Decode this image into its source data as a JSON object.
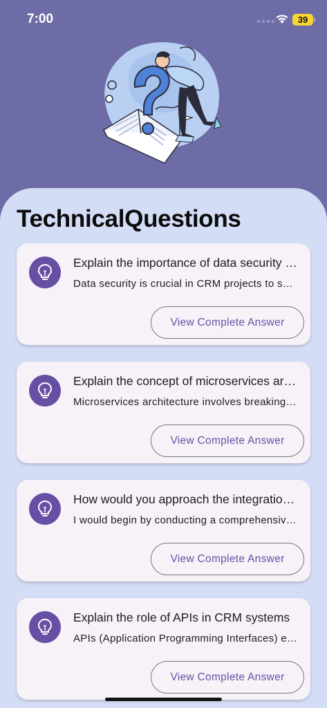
{
  "status": {
    "time": "7:00",
    "battery": "39"
  },
  "page": {
    "title": "TechnicalQuestions"
  },
  "questions": [
    {
      "question": "Explain the importance of data security in CRM projects",
      "answer": "Data security is crucial in CRM projects to safeguard sensitive customer information",
      "button": "View Complete Answer"
    },
    {
      "question": "Explain the concept of microservices architecture",
      "answer": "Microservices architecture involves breaking down an application into small services",
      "button": "View Complete Answer"
    },
    {
      "question": "How would you approach the integration of a CRM system",
      "answer": "I would begin by conducting a comprehensive analysis of the existing systems",
      "button": "View Complete Answer"
    },
    {
      "question": "Explain the role of APIs in CRM systems",
      "answer": "APIs (Application Programming Interfaces) enable communication between systems",
      "button": "View Complete Answer"
    }
  ],
  "colors": {
    "header_bg": "#6e6ca6",
    "sheet_bg": "#d4ddf6",
    "card_bg": "#f6f2f8",
    "accent": "#6750a4"
  },
  "icons": {
    "card_icon": "lightbulb-icon"
  }
}
